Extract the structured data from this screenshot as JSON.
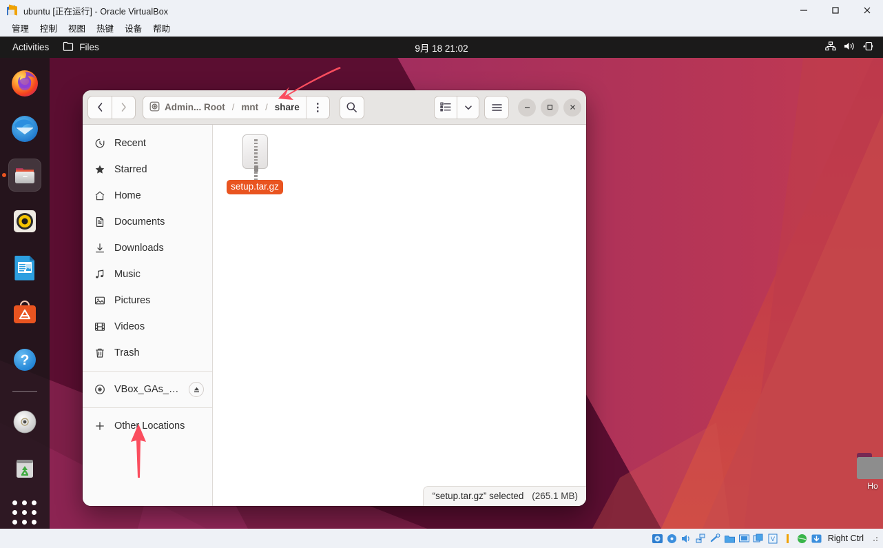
{
  "host": {
    "title": "ubuntu [正在运行] - Oracle VirtualBox",
    "app_icon": "virtualbox-icon",
    "menus": [
      "管理",
      "控制",
      "视图",
      "热键",
      "设备",
      "帮助"
    ],
    "window_controls": {
      "minimize": "minimize-icon",
      "maximize": "maximize-icon",
      "close": "close-icon"
    },
    "statusbar": {
      "icons": [
        "harddisk-icon",
        "optical-disk-icon",
        "audio-icon",
        "network-icon",
        "usb-icon",
        "shared-folder-icon",
        "display-icon",
        "recording-icon",
        "vm-icon",
        "text-cursor-icon",
        "globe-icon",
        "host-key-icon"
      ],
      "host_key": "Right Ctrl"
    }
  },
  "guest": {
    "topbar": {
      "activities": "Activities",
      "app_name": "Files",
      "app_icon": "files-folder-icon",
      "clock": "9月 18  21:02",
      "indicators": [
        "network-icon",
        "volume-icon",
        "battery-icon"
      ]
    },
    "dock": {
      "items": [
        {
          "name": "firefox",
          "label": "Firefox",
          "active": false
        },
        {
          "name": "thunderbird",
          "label": "Thunderbird",
          "active": false
        },
        {
          "name": "files",
          "label": "Files",
          "active": true
        },
        {
          "name": "rhythmbox",
          "label": "Rhythmbox",
          "active": false
        },
        {
          "name": "libreoffice-impress",
          "label": "LibreOffice Impress",
          "active": false
        },
        {
          "name": "ubuntu-software",
          "label": "Ubuntu Software",
          "active": false
        },
        {
          "name": "help",
          "label": "Help",
          "active": false
        },
        {
          "name": "cd-drive",
          "label": "VBox_GAs_7.0.14",
          "active": false
        },
        {
          "name": "trash",
          "label": "Trash",
          "active": false
        }
      ],
      "show_apps": "show-applications"
    },
    "desktop_icon": {
      "label": "Ho"
    }
  },
  "nautilus": {
    "nav": {
      "back": "back-icon",
      "forward": "forward-icon"
    },
    "breadcrumb": {
      "device_icon": "disk-icon",
      "segments": [
        {
          "text": "Admin... Root",
          "current": false
        },
        {
          "text": "mnt",
          "current": false
        },
        {
          "text": "share",
          "current": true
        }
      ],
      "separator": "/",
      "menu": "⋮"
    },
    "search": "search-icon",
    "view_toggle": {
      "list": "list-view-icon",
      "chevron": "chevron-down-icon"
    },
    "menu": "hamburger-icon",
    "window_controls": {
      "minimize": "—",
      "maximize": "□",
      "close": "✕"
    },
    "sidebar": {
      "items": [
        {
          "label": "Recent",
          "icon": "clock-icon"
        },
        {
          "label": "Starred",
          "icon": "star-icon"
        },
        {
          "label": "Home",
          "icon": "home-icon"
        },
        {
          "label": "Documents",
          "icon": "document-icon"
        },
        {
          "label": "Downloads",
          "icon": "download-icon"
        },
        {
          "label": "Music",
          "icon": "music-note-icon"
        },
        {
          "label": "Pictures",
          "icon": "picture-icon"
        },
        {
          "label": "Videos",
          "icon": "film-icon"
        },
        {
          "label": "Trash",
          "icon": "trash-icon"
        }
      ],
      "devices": [
        {
          "label": "VBox_GAs_7....",
          "icon": "optical-disc-icon",
          "eject": "eject-icon"
        }
      ],
      "other": {
        "label": "Other Locations",
        "icon": "plus-icon"
      }
    },
    "files": [
      {
        "name": "setup.tar.gz",
        "icon": "archive-icon",
        "selected": true
      }
    ],
    "status": {
      "text": "“setup.tar.gz” selected",
      "size": "(265.1 MB)"
    }
  },
  "annotations": [
    {
      "name": "arrow-to-breadcrumb",
      "color": "#fa4d5e"
    },
    {
      "name": "arrow-to-other-locations",
      "color": "#fa4d5e"
    }
  ],
  "colors": {
    "accent": "#e95420",
    "annotation": "#fa4d5e",
    "topbar_bg": "#1b1a1a",
    "header_bg": "#e7e5e3"
  }
}
